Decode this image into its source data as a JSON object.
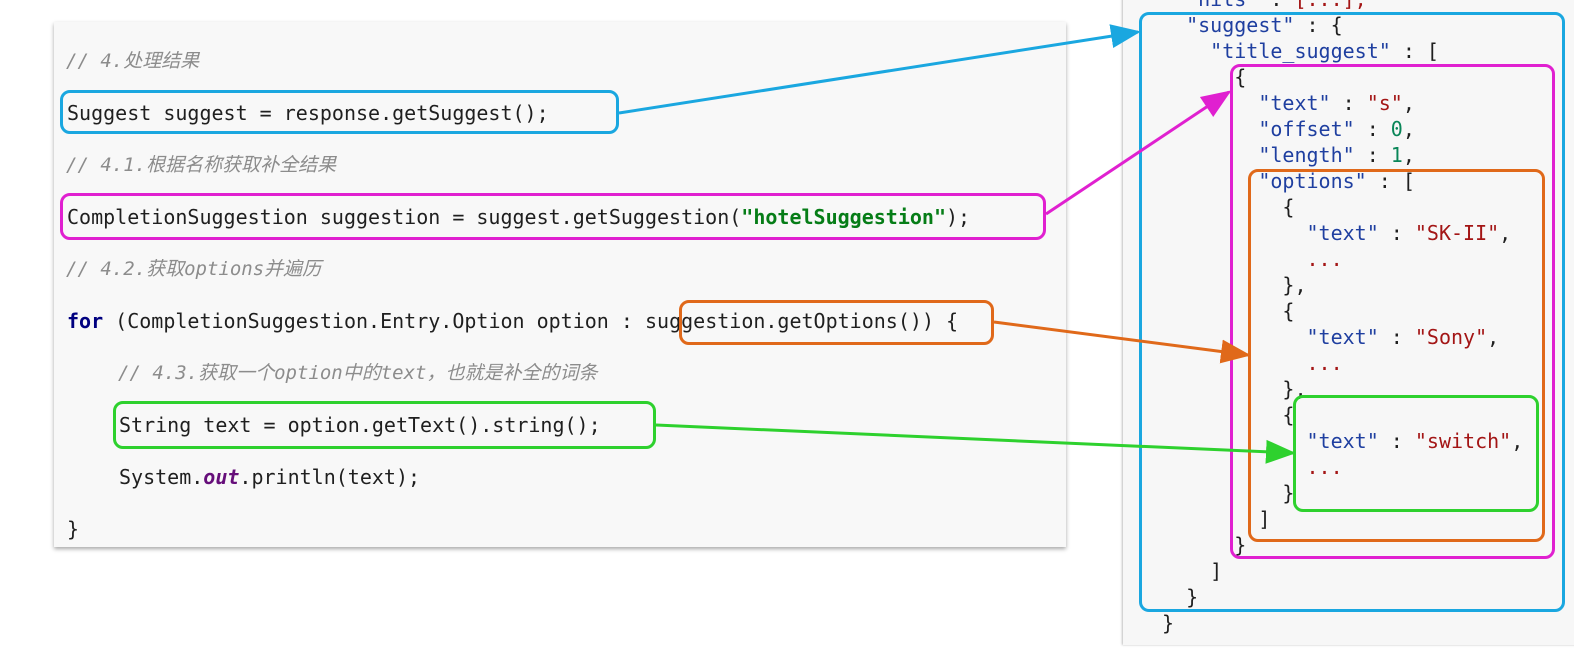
{
  "code": {
    "c1": "// 4.处理结果",
    "l1": "Suggest suggest = response.getSuggest();",
    "c2": "// 4.1.根据名称获取补全结果",
    "l2_pre": "CompletionSuggestion suggestion = suggest.getSuggestion(",
    "l2_str": "\"hotelSuggestion\"",
    "l2_post": ");",
    "c3": "// 4.2.获取options并遍历",
    "l3_kw": "for",
    "l3_mid": " (CompletionSuggestion.Entry.Option option : ",
    "l3_call": "suggestion.getOptions()",
    "l3_end": ") {",
    "c4": "// 4.3.获取一个option中的text，也就是补全的词条",
    "l4": "String text = option.getText().string();",
    "l5_pre": "System.",
    "l5_fld": "out",
    "l5_post": ".println(text);",
    "l6": "}"
  },
  "json": {
    "hits_key": "\"hits\"",
    "hits_val": "[...],",
    "suggest_key": "\"suggest\"",
    "title_key": "\"title_suggest\"",
    "text_key": "\"text\"",
    "text_val": "\"s\"",
    "offset_key": "\"offset\"",
    "offset_val": "0",
    "length_key": "\"length\"",
    "length_val": "1",
    "options_key": "\"options\"",
    "opt1_val": "\"SK-II\"",
    "opt2_val": "\"Sony\"",
    "opt3_val": "\"switch\"",
    "ellipsis": "..."
  },
  "colors": {
    "blue": "#1aa7e0",
    "magenta": "#e020d0",
    "orange": "#e0691a",
    "green": "#2ed12e"
  }
}
